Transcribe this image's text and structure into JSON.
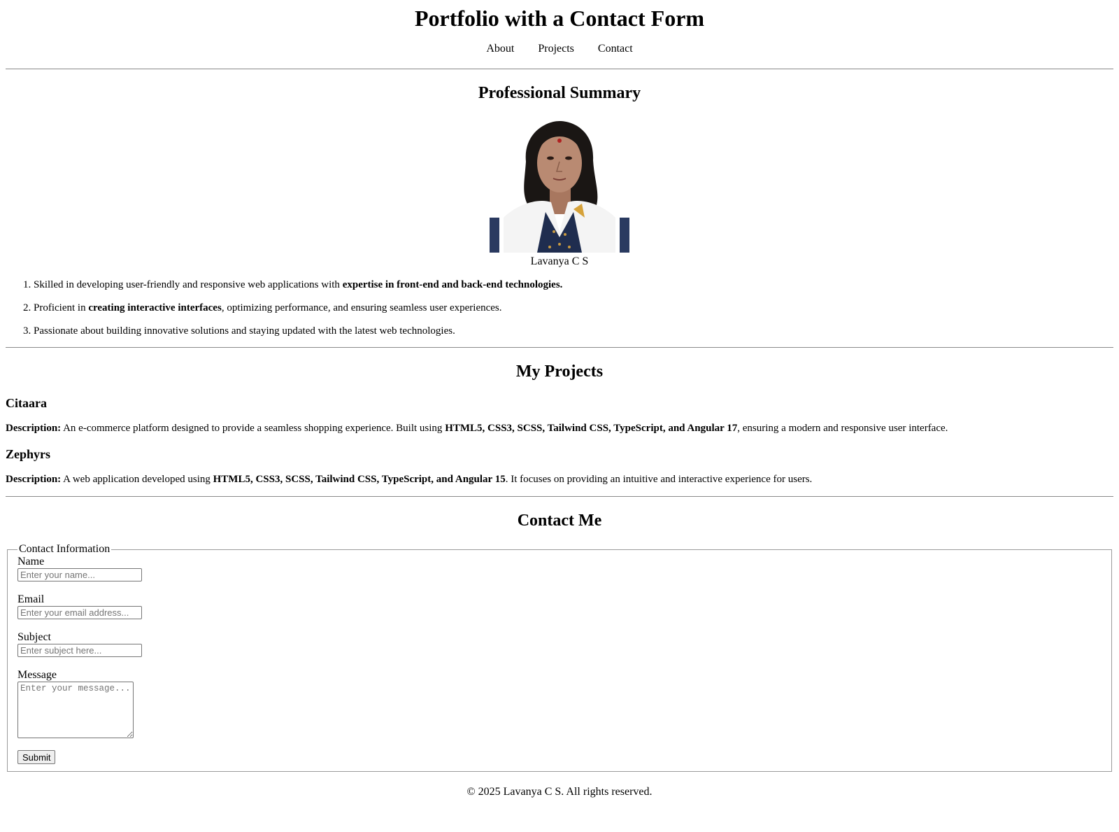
{
  "header": {
    "title": "Portfolio with a Contact Form",
    "nav": [
      "About",
      "Projects",
      "Contact"
    ]
  },
  "summary": {
    "heading": "Professional Summary",
    "name": "Lavanya C S",
    "points": [
      {
        "pre": "Skilled in developing user-friendly and responsive web applications with ",
        "bold": "expertise in front-end and back-end technologies.",
        "post": ""
      },
      {
        "pre": "Proficient in ",
        "bold": "creating interactive interfaces",
        "post": ", optimizing performance, and ensuring seamless user experiences."
      },
      {
        "pre": "Passionate about building innovative solutions and staying updated with the latest web technologies.",
        "bold": "",
        "post": ""
      }
    ]
  },
  "projects": {
    "heading": "My Projects",
    "items": [
      {
        "name": "Citaara",
        "label": "Description:",
        "pre": " An e-commerce platform designed to provide a seamless shopping experience. Built using ",
        "bold": "HTML5, CSS3, SCSS, Tailwind CSS, TypeScript, and Angular 17",
        "post": ", ensuring a modern and responsive user interface."
      },
      {
        "name": "Zephyrs",
        "label": "Description:",
        "pre": " A web application developed using ",
        "bold": "HTML5, CSS3, SCSS, Tailwind CSS, TypeScript, and Angular 15",
        "post": ". It focuses on providing an intuitive and interactive experience for users."
      }
    ]
  },
  "contact": {
    "heading": "Contact Me",
    "legend": "Contact Information",
    "fields": {
      "name": {
        "label": "Name",
        "placeholder": "Enter your name..."
      },
      "email": {
        "label": "Email",
        "placeholder": "Enter your email address..."
      },
      "subject": {
        "label": "Subject",
        "placeholder": "Enter subject here..."
      },
      "message": {
        "label": "Message",
        "placeholder": "Enter your message..."
      }
    },
    "submit_label": "Submit"
  },
  "footer": {
    "text": "© 2025 Lavanya C S. All rights reserved."
  }
}
